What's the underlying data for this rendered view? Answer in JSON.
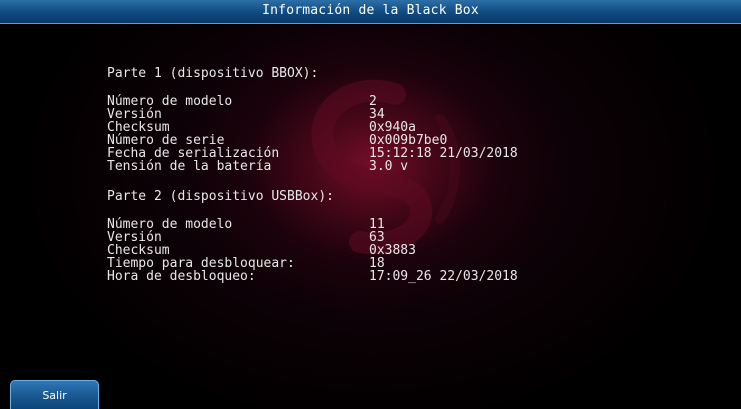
{
  "window": {
    "title": "Información de la Black Box"
  },
  "part1": {
    "heading": "Parte 1 (dispositivo BBOX):",
    "rows": [
      {
        "label": "Número de modelo",
        "value": "2"
      },
      {
        "label": "Versión",
        "value": "34"
      },
      {
        "label": "Checksum",
        "value": "0x940a"
      },
      {
        "label": "Número de serie",
        "value": "0x009b7be0"
      },
      {
        "label": "Fecha de serialización",
        "value": "15:12:18 21/03/2018"
      },
      {
        "label": "Tensión de la batería",
        "value": "3.0 v"
      }
    ]
  },
  "part2": {
    "heading": "Parte 2 (dispositivo USBBox):",
    "rows": [
      {
        "label": "Número de modelo",
        "value": "11"
      },
      {
        "label": "Versión",
        "value": "63"
      },
      {
        "label": "Checksum",
        "value": "0x3883"
      },
      {
        "label": "Tiempo para desbloquear:",
        "value": "18"
      },
      {
        "label": "Hora de desbloqueo:",
        "value": "17:09_26 22/03/2018"
      }
    ]
  },
  "footer": {
    "exit_label": "Salir"
  },
  "colors": {
    "title_bar": "#0f4a80",
    "background": "#000000",
    "glow": "#780e28",
    "text": "#e8e8e8",
    "button": "#1a5a94"
  },
  "icons": {
    "watermark": "logo-watermark-icon"
  }
}
